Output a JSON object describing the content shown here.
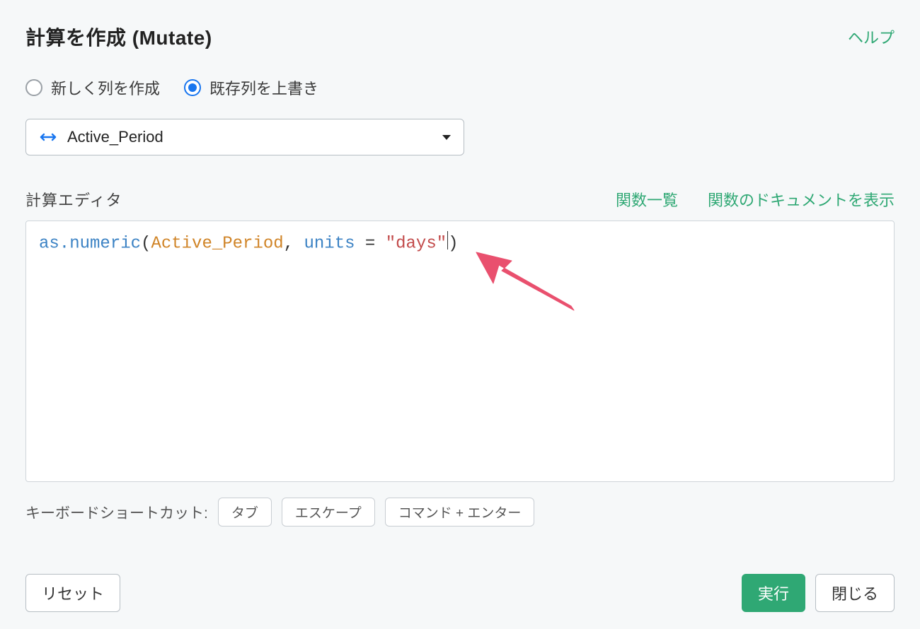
{
  "header": {
    "title": "計算を作成 (Mutate)",
    "help": "ヘルプ"
  },
  "mode": {
    "create_label": "新しく列を作成",
    "overwrite_label": "既存列を上書き",
    "selected": "overwrite"
  },
  "column_select": {
    "value": "Active_Period"
  },
  "editor": {
    "label": "計算エディタ",
    "fn_list_link": "関数一覧",
    "fn_doc_link": "関数のドキュメントを表示",
    "code": {
      "fn": "as.numeric",
      "open": "(",
      "id": "Active_Period",
      "comma": ", ",
      "arg_name": "units",
      "eq": " = ",
      "str_open": "\"",
      "str_val": "days",
      "str_close": "\"",
      "close": ")"
    }
  },
  "shortcuts": {
    "label": "キーボードショートカット:",
    "keys": [
      "タブ",
      "エスケープ",
      "コマンド + エンター"
    ]
  },
  "footer": {
    "reset": "リセット",
    "run": "実行",
    "close": "閉じる"
  }
}
